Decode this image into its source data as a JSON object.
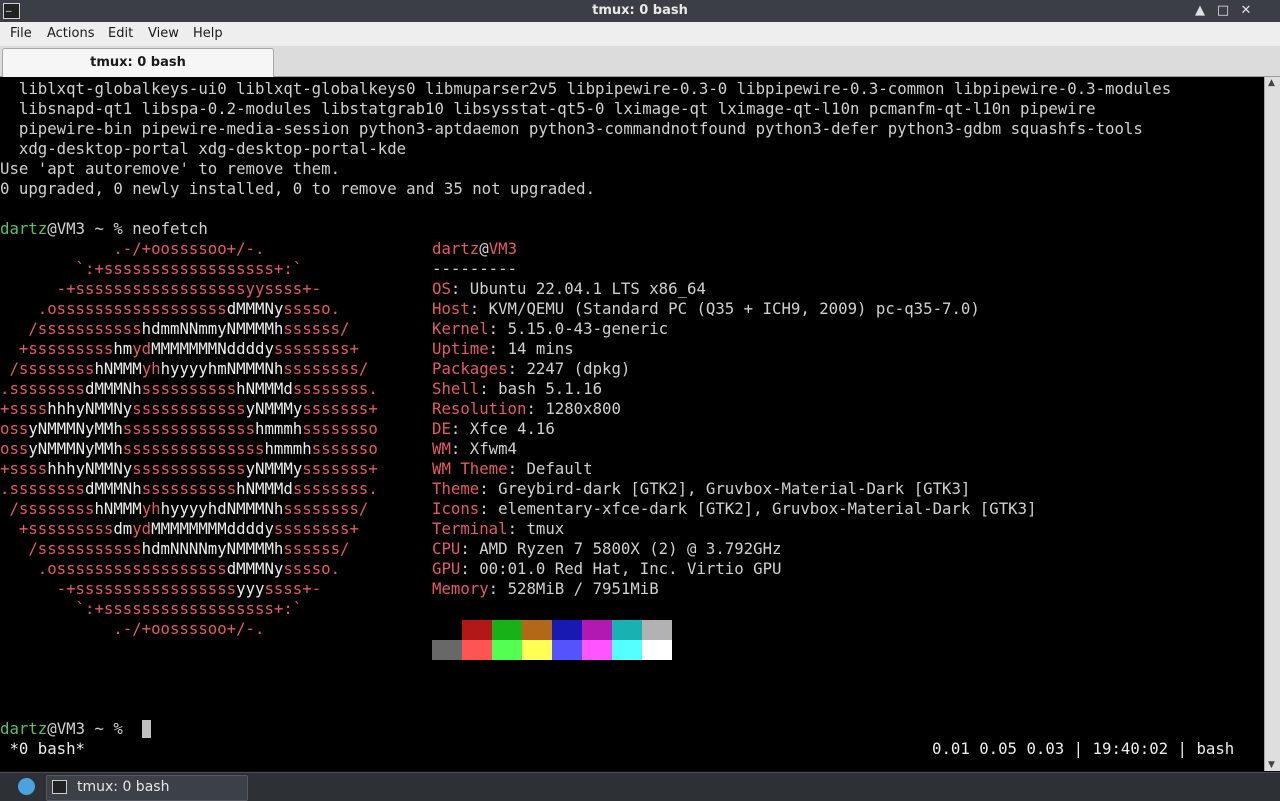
{
  "window": {
    "title": "tmux: 0 bash",
    "minimize": "▲",
    "maximize": "□",
    "close": "✕"
  },
  "menu": [
    "File",
    "Actions",
    "Edit",
    "View",
    "Help"
  ],
  "tab": {
    "label": "tmux: 0 bash"
  },
  "output": [
    "  liblxqt-globalkeys-ui0 liblxqt-globalkeys0 libmuparser2v5 libpipewire-0.3-0 libpipewire-0.3-common libpipewire-0.3-modules",
    "  libsnapd-qt1 libspa-0.2-modules libstatgrab10 libsysstat-qt5-0 lximage-qt lximage-qt-l10n pcmanfm-qt-l10n pipewire",
    "  pipewire-bin pipewire-media-session python3-aptdaemon python3-commandnotfound python3-defer python3-gdbm squashfs-tools",
    "  xdg-desktop-portal xdg-desktop-portal-kde",
    "Use 'apt autoremove' to remove them.",
    "0 upgraded, 0 newly installed, 0 to remove and 35 not upgraded."
  ],
  "prompt": {
    "user": "dartz",
    "at": "@",
    "host": "VM3",
    "rest": " ~ % ",
    "command": "neofetch"
  },
  "logo": [
    [
      [
        "r",
        "            .-/+oossssoo+/-.               "
      ]
    ],
    [
      [
        "r",
        "        `:+ssssssssssssssssss+:`           "
      ]
    ],
    [
      [
        "r",
        "      -+ssssssssssssssssssyyssss+-         "
      ]
    ],
    [
      [
        "r",
        "    .ossssssssssssssssss"
      ],
      [
        "w",
        "dMMMNy"
      ],
      [
        "r",
        "sssso.       "
      ]
    ],
    [
      [
        "r",
        "   /sssssssssss"
      ],
      [
        "w",
        "hdmmNNmmyNMMMMh"
      ],
      [
        "r",
        "ssssss/      "
      ]
    ],
    [
      [
        "r",
        "  +sssssssss"
      ],
      [
        "w",
        "hm"
      ],
      [
        "r",
        "yd"
      ],
      [
        "w",
        "MMMMMMMNddddy"
      ],
      [
        "r",
        "ssssssss+     "
      ]
    ],
    [
      [
        "r",
        " /ssssssss"
      ],
      [
        "w",
        "hNMMM"
      ],
      [
        "r",
        "yh"
      ],
      [
        "w",
        "hyyyyhmNMMMNh"
      ],
      [
        "r",
        "ssssssss/    "
      ]
    ],
    [
      [
        "r",
        ".ssssssss"
      ],
      [
        "w",
        "dMMMNh"
      ],
      [
        "r",
        "ssssssssss"
      ],
      [
        "w",
        "hNMMMd"
      ],
      [
        "r",
        "ssssssss.    "
      ]
    ],
    [
      [
        "r",
        "+ssss"
      ],
      [
        "w",
        "hhhyNMMNy"
      ],
      [
        "r",
        "ssssssssssss"
      ],
      [
        "w",
        "yNMMMy"
      ],
      [
        "r",
        "sssssss+    "
      ]
    ],
    [
      [
        "r",
        "oss"
      ],
      [
        "w",
        "yNMMMNyMMh"
      ],
      [
        "r",
        "ssssssssssssss"
      ],
      [
        "w",
        "hmmmh"
      ],
      [
        "r",
        "ssssssso    "
      ]
    ],
    [
      [
        "r",
        "oss"
      ],
      [
        "w",
        "yNMMMNyMMh"
      ],
      [
        "r",
        "sssssssssssssss"
      ],
      [
        "w",
        "hmmmh"
      ],
      [
        "r",
        "sssssso    "
      ]
    ],
    [
      [
        "r",
        "+ssss"
      ],
      [
        "w",
        "hhhyNMMNy"
      ],
      [
        "r",
        "ssssssssssss"
      ],
      [
        "w",
        "yNMMMy"
      ],
      [
        "r",
        "sssssss+    "
      ]
    ],
    [
      [
        "r",
        ".ssssssss"
      ],
      [
        "w",
        "dMMMNh"
      ],
      [
        "r",
        "ssssssssss"
      ],
      [
        "w",
        "hNMMMd"
      ],
      [
        "r",
        "ssssssss.    "
      ]
    ],
    [
      [
        "r",
        " /ssssssss"
      ],
      [
        "w",
        "hNMMM"
      ],
      [
        "r",
        "yh"
      ],
      [
        "w",
        "hyyyyhdNMMMNh"
      ],
      [
        "r",
        "ssssssss/    "
      ]
    ],
    [
      [
        "r",
        "  +sssssssss"
      ],
      [
        "w",
        "dm"
      ],
      [
        "r",
        "yd"
      ],
      [
        "w",
        "MMMMMMMMddddy"
      ],
      [
        "r",
        "ssssssss+     "
      ]
    ],
    [
      [
        "r",
        "   /sssssssssss"
      ],
      [
        "w",
        "hdmNNNNmyNMMMMh"
      ],
      [
        "r",
        "ssssss/      "
      ]
    ],
    [
      [
        "r",
        "    .ossssssssssssssssss"
      ],
      [
        "w",
        "dMMMNy"
      ],
      [
        "r",
        "sssso.       "
      ]
    ],
    [
      [
        "r",
        "      -+sssssssssssssssss"
      ],
      [
        "w",
        "yyy"
      ],
      [
        "r",
        "ssss+-        "
      ]
    ],
    [
      [
        "r",
        "        `:+ssssssssssssssssss+:`           "
      ]
    ],
    [
      [
        "r",
        "            .-/+oossssoo+/-.               "
      ]
    ]
  ],
  "sysinfo": {
    "user": "dartz",
    "at": "@",
    "host": "VM3",
    "sep": "---------",
    "fields": [
      {
        "key": "OS",
        "value": "Ubuntu 22.04.1 LTS x86_64"
      },
      {
        "key": "Host",
        "value": "KVM/QEMU (Standard PC (Q35 + ICH9, 2009) pc-q35-7.0)"
      },
      {
        "key": "Kernel",
        "value": "5.15.0-43-generic"
      },
      {
        "key": "Uptime",
        "value": "14 mins"
      },
      {
        "key": "Packages",
        "value": "2247 (dpkg)"
      },
      {
        "key": "Shell",
        "value": "bash 5.1.16"
      },
      {
        "key": "Resolution",
        "value": "1280x800"
      },
      {
        "key": "DE",
        "value": "Xfce 4.16"
      },
      {
        "key": "WM",
        "value": "Xfwm4"
      },
      {
        "key": "WM Theme",
        "value": "Default"
      },
      {
        "key": "Theme",
        "value": "Greybird-dark [GTK2], Gruvbox-Material-Dark [GTK3]"
      },
      {
        "key": "Icons",
        "value": "elementary-xfce-dark [GTK2], Gruvbox-Material-Dark [GTK3]"
      },
      {
        "key": "Terminal",
        "value": "tmux"
      },
      {
        "key": "CPU",
        "value": "AMD Ryzen 7 5800X (2) @ 3.792GHz"
      },
      {
        "key": "GPU",
        "value": "00:01.0 Red Hat, Inc. Virtio GPU"
      },
      {
        "key": "Memory",
        "value": "528MiB / 7951MiB"
      }
    ]
  },
  "palette": {
    "normal": [
      "#000000",
      "#b21818",
      "#18b218",
      "#b26818",
      "#1818b2",
      "#b218b2",
      "#18b2b2",
      "#b2b2b2"
    ],
    "bright": [
      "#686868",
      "#ff5454",
      "#54ff54",
      "#ffff54",
      "#5454ff",
      "#ff54ff",
      "#54ffff",
      "#ffffff"
    ]
  },
  "prompt2": {
    "user": "dartz",
    "at": "@",
    "host": "VM3",
    "rest": " ~ % "
  },
  "status": {
    "left": " *0 bash*",
    "right": "0.01 0.05 0.03 | 19:40:02 | bash"
  },
  "taskbar": {
    "task_label": "tmux: 0 bash"
  },
  "colors": {
    "logo": "#e45b67",
    "accent": "#e45b67",
    "prompt_user": "#55c468",
    "text": "#d0d0d0"
  },
  "icons": [
    "terminal-icon",
    "minimize-icon",
    "maximize-icon",
    "close-icon",
    "menu-launcher-icon"
  ]
}
